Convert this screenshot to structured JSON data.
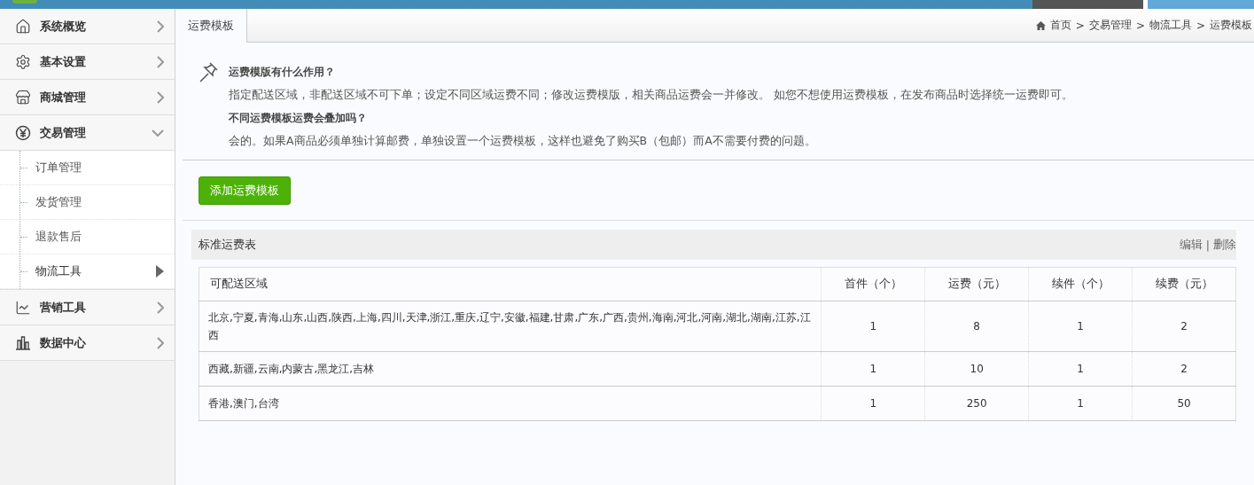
{
  "sidebar": {
    "items": [
      {
        "label": "系统概览",
        "expanded": false
      },
      {
        "label": "基本设置",
        "expanded": false
      },
      {
        "label": "商城管理",
        "expanded": false
      },
      {
        "label": "交易管理",
        "expanded": true,
        "children": [
          {
            "label": "订单管理",
            "selected": false
          },
          {
            "label": "发货管理",
            "selected": false
          },
          {
            "label": "退款售后",
            "selected": false
          },
          {
            "label": "物流工具",
            "selected": true
          }
        ]
      },
      {
        "label": "营销工具",
        "expanded": false
      },
      {
        "label": "数据中心",
        "expanded": false
      }
    ]
  },
  "tabs": [
    {
      "label": "运费模板",
      "selected": true
    }
  ],
  "breadcrumb": {
    "items": [
      "首页",
      "交易管理",
      "物流工具",
      "运费模板"
    ],
    "separator": ">"
  },
  "help": [
    {
      "question": "运费模版有什么作用？",
      "answer": "指定配送区域，非配送区域不可下单；设定不同区域运费不同；修改运费模版，相关商品运费会一并修改。 如您不想使用运费模板，在发布商品时选择统一运费即可。"
    },
    {
      "question": "不同运费模板运费会叠加吗？",
      "answer": "会的。如果A商品必须单独计算邮费，单独设置一个运费模板，这样也避免了购买B（包邮）而A不需要付费的问题。"
    }
  ],
  "add_button": "添加运费模板",
  "template": {
    "title": "标准运费表",
    "actions": [
      "编辑",
      "删除"
    ],
    "action_separator": "|",
    "table": {
      "columns": [
        "可配送区域",
        "首件（个）",
        "运费（元）",
        "续件（个）",
        "续费（元）"
      ],
      "rows": [
        [
          "北京,宁夏,青海,山东,山西,陕西,上海,四川,天津,浙江,重庆,辽宁,安徽,福建,甘肃,广东,广西,贵州,海南,河北,河南,湖北,湖南,江苏,江西",
          "1",
          "8",
          "1",
          "2"
        ],
        [
          "西藏,新疆,云南,内蒙古,黑龙江,吉林",
          "1",
          "10",
          "1",
          "2"
        ],
        [
          "香港,澳门,台湾",
          "1",
          "250",
          "1",
          "50"
        ]
      ]
    }
  }
}
